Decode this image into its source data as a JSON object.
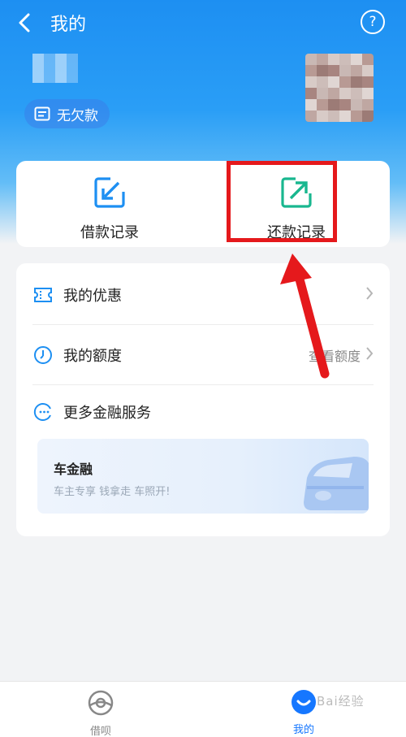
{
  "header": {
    "title": "我的",
    "help_label": "?"
  },
  "profile": {
    "debt_badge": "无欠款"
  },
  "records": {
    "borrow_label": "借款记录",
    "repay_label": "还款记录"
  },
  "menu": {
    "items": [
      {
        "label": "我的优惠",
        "aux": ""
      },
      {
        "label": "我的额度",
        "aux": "查看额度"
      },
      {
        "label": "更多金融服务",
        "aux": ""
      }
    ]
  },
  "banner": {
    "title": "车金融",
    "subtitle": "车主专享  钱拿走  车照开!"
  },
  "tabbar": {
    "tabs": [
      {
        "label": "借呗",
        "active": false
      },
      {
        "label": "我的",
        "active": true
      }
    ]
  },
  "watermark": "Bai经验",
  "colors": {
    "brand_blue": "#1d8ff2",
    "accent_green": "#19b78f",
    "highlight_red": "#e5191c",
    "tab_active": "#1677ff",
    "tab_inactive": "#888888"
  }
}
